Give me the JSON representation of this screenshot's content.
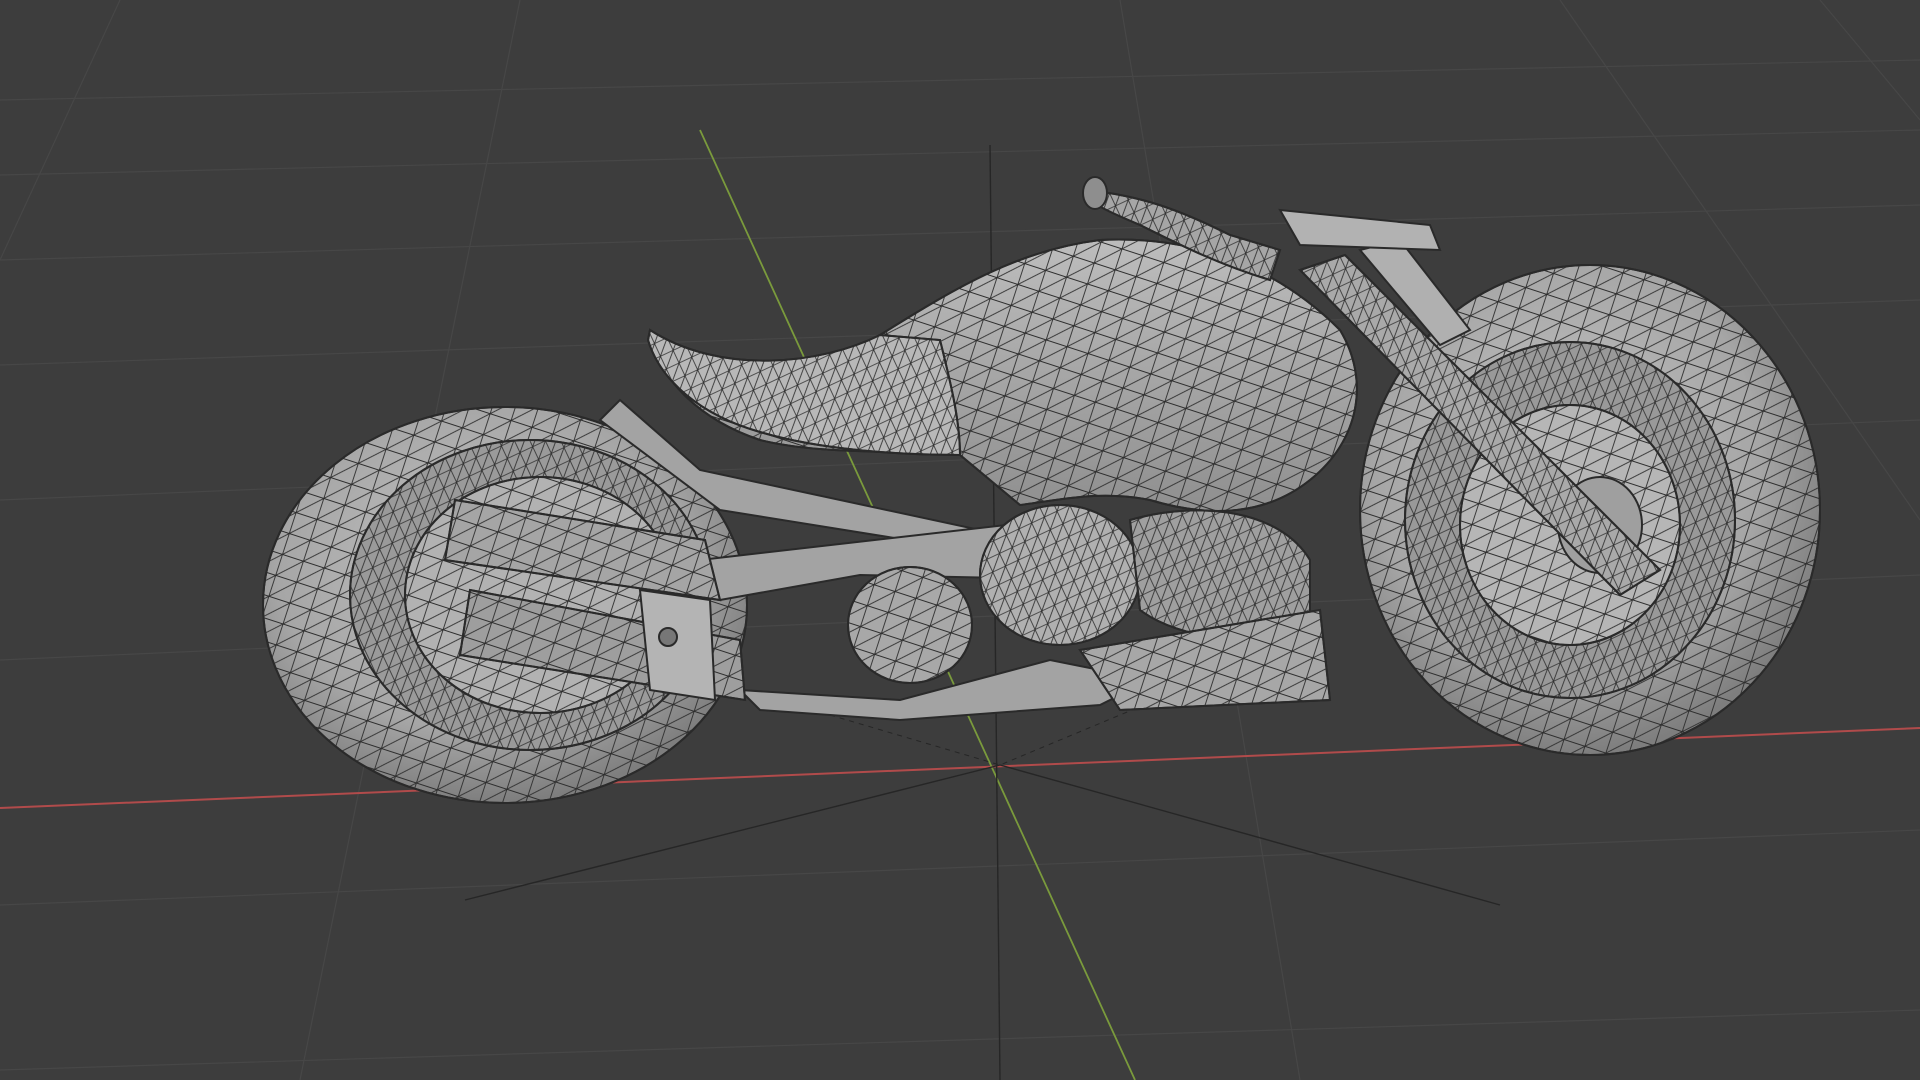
{
  "viewport": {
    "editor": "3D Viewport",
    "shading_mode": "solid-wireframe",
    "object": "motorcycle-mesh"
  },
  "colors": {
    "background": "#3d3d3d",
    "grid": "#4a4a4a",
    "axis_x": "#b14b4b",
    "axis_y": "#7a9a3c",
    "mesh_fill": "#a9a9a9",
    "mesh_shade": "#8b8b8b",
    "mesh_light": "#c4c4c4",
    "wire": "#2a2a2a"
  }
}
